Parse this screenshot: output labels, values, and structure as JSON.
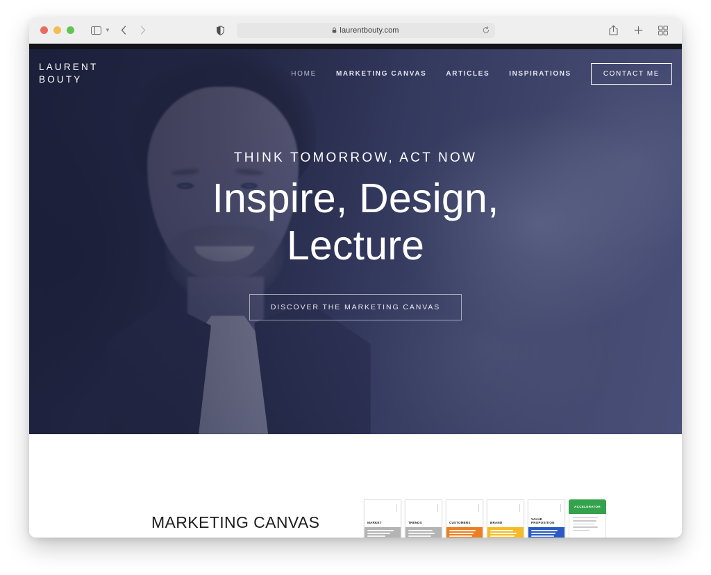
{
  "browser": {
    "url": "laurentbouty.com",
    "lock_icon": "lock-icon",
    "shield_icon": "privacy-shield-icon",
    "reload_icon": "reload-icon",
    "sidebar_icon": "sidebar-toggle-icon",
    "back_icon": "back-arrow-icon",
    "forward_icon": "forward-arrow-icon",
    "share_icon": "share-icon",
    "new_tab_icon": "plus-icon",
    "tab_overview_icon": "tab-overview-icon",
    "traffic_lights": [
      "close",
      "minimize",
      "zoom"
    ]
  },
  "site": {
    "logo_line1": "LAURENT",
    "logo_line2": "BOUTY",
    "nav": [
      {
        "label": "HOME"
      },
      {
        "label": "MARKETING CANVAS"
      },
      {
        "label": "ARTICLES"
      },
      {
        "label": "INSPIRATIONS"
      }
    ],
    "cta": "CONTACT ME"
  },
  "hero": {
    "eyebrow": "THINK TOMORROW, ACT NOW",
    "headline_line1": "Inspire, Design,",
    "headline_line2": "Lecture",
    "button": "DISCOVER THE MARKETING CANVAS",
    "overlay_color": "#262b4d",
    "portrait_alt": "smiling-man-portrait"
  },
  "section": {
    "title": "MARKETING CANVAS",
    "cards": [
      {
        "label": "MARKET",
        "color": "#b4b4b4",
        "style": "gray"
      },
      {
        "label": "TRENDS",
        "color": "#b4b4b4",
        "style": "gray"
      },
      {
        "label": "CUSTOMERS",
        "color": "#ea8023",
        "style": "orange"
      },
      {
        "label": "BRAND",
        "color": "#f5bb2a",
        "style": "yellow"
      },
      {
        "label": "VALUE PROPOSITION",
        "color": "#2a5bc4",
        "style": "blue"
      },
      {
        "label": "ACCELERATOR",
        "color": "#34a24c",
        "style": "green"
      }
    ]
  }
}
